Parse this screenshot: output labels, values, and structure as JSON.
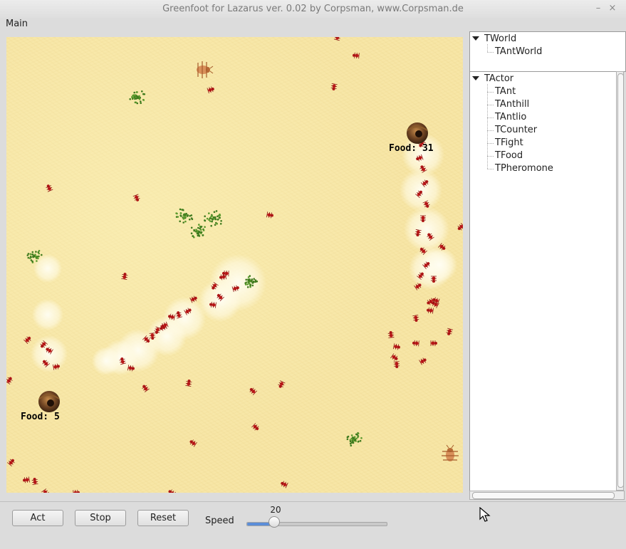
{
  "window": {
    "title": "Greenfoot for Lazarus ver. 0.02 by Corpsman, www.Corpsman.de",
    "minimize_glyph": "–",
    "close_glyph": "×"
  },
  "menu": {
    "main_label": "Main"
  },
  "world": {
    "counters": [
      {
        "label": "Food: 31"
      },
      {
        "label": "Food: 5"
      }
    ],
    "colors": {
      "sand": "#f7e6a6",
      "ant": "#c01818",
      "food": "#3f7a1e",
      "pheromone": "#fffbe6"
    }
  },
  "class_tree": {
    "world_root": "TWorld",
    "world_children": [
      "TAntWorld"
    ],
    "actor_root": "TActor",
    "actor_children": [
      "TAnt",
      "TAnthill",
      "TAntlio",
      "TCounter",
      "TFight",
      "TFood",
      "TPheromone"
    ]
  },
  "controls": {
    "act_label": "Act",
    "stop_label": "Stop",
    "reset_label": "Reset",
    "speed_label": "Speed",
    "speed_value": "20",
    "speed_min": 0,
    "speed_max": 100
  },
  "icons": {
    "tree_expand": "triangle-down-icon",
    "cursor": "mouse-pointer-icon"
  }
}
